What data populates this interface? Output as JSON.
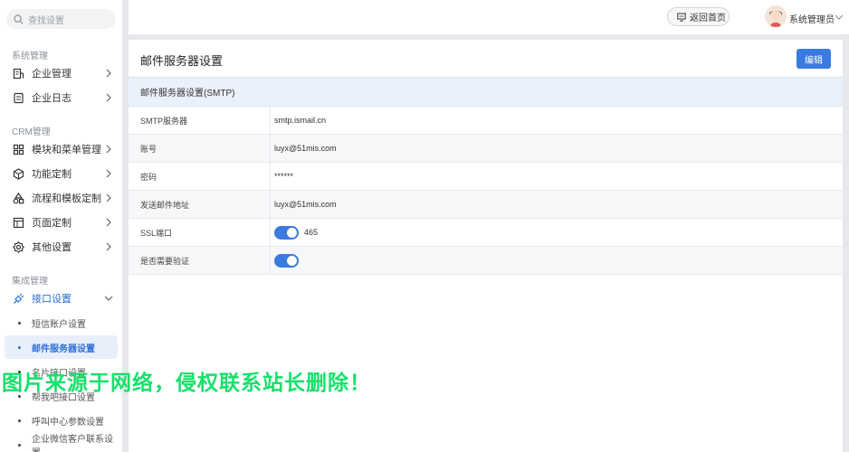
{
  "sidebar": {
    "search_placeholder": "查找设置",
    "groups": {
      "system": "系统管理",
      "crm": "CRM管理",
      "integration": "集成管理"
    },
    "items": {
      "enterprise_mgmt": "企业管理",
      "enterprise_log": "企业日志",
      "module_menu": "模块和菜单管理",
      "feature_custom": "功能定制",
      "flow_template": "流程和模板定制",
      "page_custom": "页面定制",
      "other_settings": "其他设置",
      "api_settings": "接口设置"
    },
    "sub_items": {
      "sms": "短信账户设置",
      "mail": "邮件服务器设置",
      "card": "名片接口设置",
      "helper": "帮我吧接口设置",
      "callcenter": "呼叫中心参数设置",
      "wechat": "企业微信客户联系设置"
    }
  },
  "header": {
    "home_button": "返回首页",
    "user_name": "系统管理员"
  },
  "main": {
    "title": "邮件服务器设置",
    "edit_button": "编辑",
    "section_title": "邮件服务器设置(SMTP)",
    "rows": [
      {
        "label": "SMTP服务器",
        "value": "smtp.ismail.cn"
      },
      {
        "label": "账号",
        "value": "luyx@51mis.com"
      },
      {
        "label": "密码",
        "value": "******"
      },
      {
        "label": "发送邮件地址",
        "value": "luyx@51mis.com"
      },
      {
        "label": "SSL端口",
        "value": "465",
        "toggle": true
      },
      {
        "label": "是否需要验证",
        "value": "",
        "toggle": true
      }
    ]
  },
  "watermark": "图片来源于网络，侵权联系站长删除！",
  "colors": {
    "accent": "#3a7be0",
    "active_bg": "#e8effb",
    "watermark": "#16e06a"
  }
}
